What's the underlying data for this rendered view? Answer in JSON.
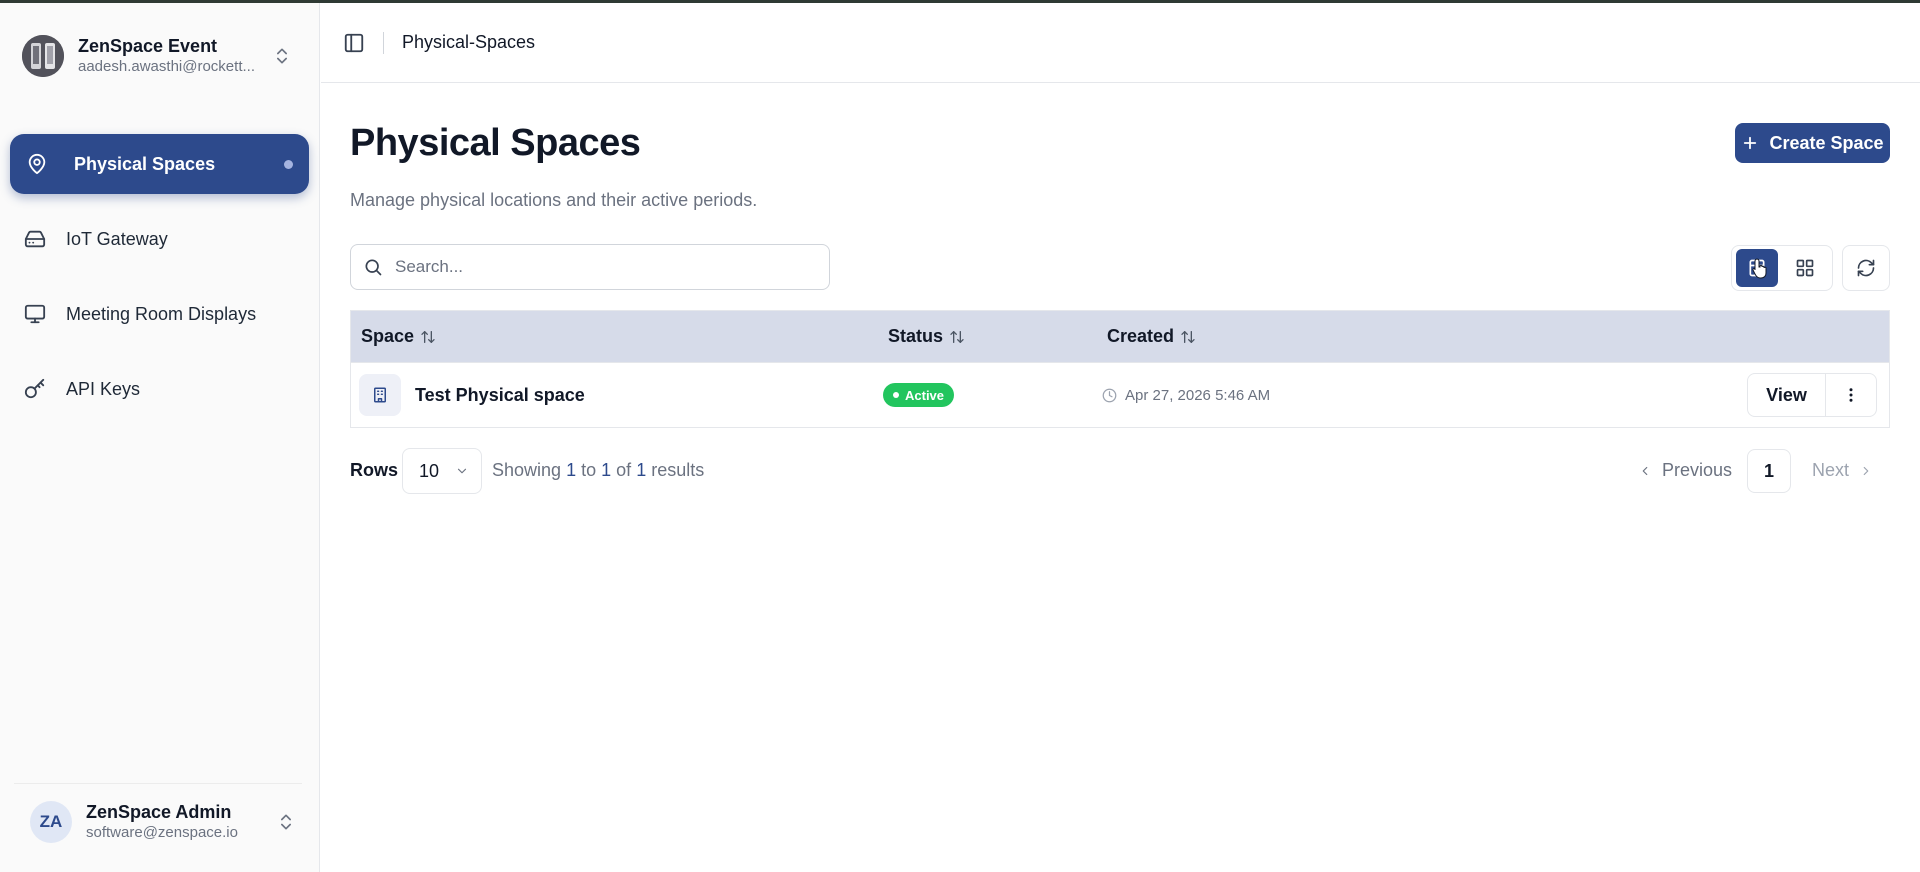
{
  "org": {
    "name": "ZenSpace Event",
    "email": "aadesh.awasthi@rockett..."
  },
  "sidebar": {
    "items": [
      {
        "label": "Physical Spaces",
        "icon": "map-pin-icon",
        "active": true
      },
      {
        "label": "IoT Gateway",
        "icon": "hard-drive-icon",
        "active": false
      },
      {
        "label": "Meeting Room Displays",
        "icon": "monitor-icon",
        "active": false
      },
      {
        "label": "API Keys",
        "icon": "key-icon",
        "active": false
      }
    ]
  },
  "user": {
    "initials": "ZA",
    "name": "ZenSpace Admin",
    "email": "software@zenspace.io"
  },
  "header": {
    "breadcrumb": "Physical-Spaces"
  },
  "main": {
    "title": "Physical Spaces",
    "subtitle": "Manage physical locations and their active periods.",
    "create_label": "Create Space",
    "search_placeholder": "Search..."
  },
  "table": {
    "columns": [
      "Space",
      "Status",
      "Created"
    ],
    "rows": [
      {
        "space": "Test Physical space",
        "status": "Active",
        "created": "Apr 27, 2026 5:46 AM",
        "view_label": "View"
      }
    ]
  },
  "pagination": {
    "rows_label": "Rows",
    "rows_per_page": "10",
    "showing_prefix": "Showing",
    "from": "1",
    "to_word": "to",
    "to": "1",
    "of_word": "of",
    "total": "1",
    "results_word": "results",
    "previous_label": "Previous",
    "current_page": "1",
    "next_label": "Next"
  },
  "colors": {
    "accent": "#2d4a8c",
    "table_header": "#d6dbe9",
    "status_active": "#22c55e"
  }
}
